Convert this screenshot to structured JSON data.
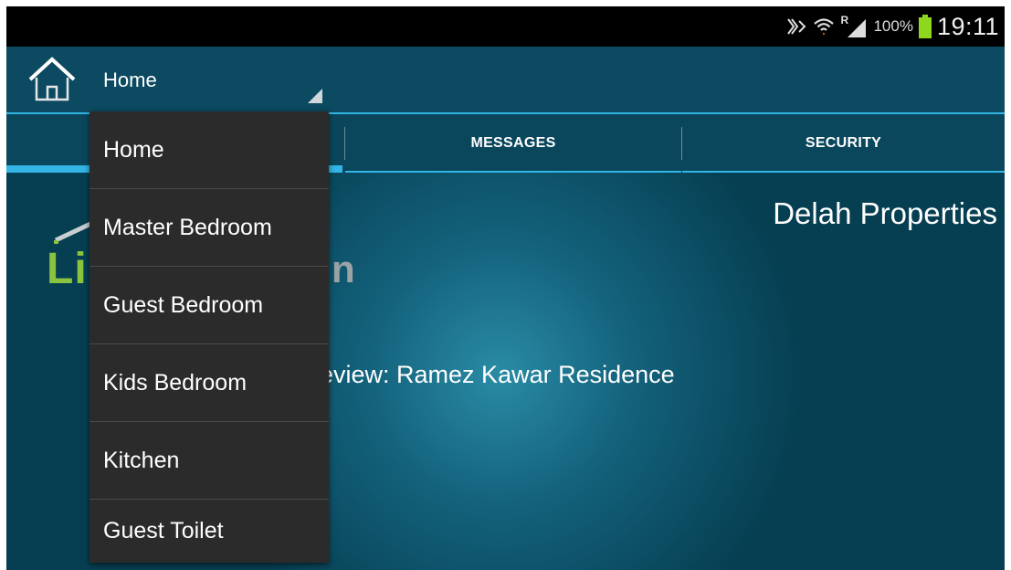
{
  "status_bar": {
    "battery_percent": "100%",
    "time": "19:11",
    "icons": [
      "nfc-icon",
      "wifi-icon",
      "roaming-icon",
      "signal-icon",
      "battery-icon"
    ],
    "roaming_label": "R",
    "battery_color": "#8fd61f"
  },
  "action_bar": {
    "spinner_selected": "Home",
    "home_icon": "house-icon",
    "accent_color": "#33b5e5"
  },
  "tabs": [
    {
      "label": ""
    },
    {
      "label": "MESSAGES"
    },
    {
      "label": "SECURITY"
    }
  ],
  "content": {
    "property_name": "Delah Properties",
    "preview_text": "eview: Ramez Kawar Residence",
    "logo_visible_left": "Li",
    "logo_visible_right": "n"
  },
  "dropdown": {
    "items": [
      {
        "label": "Home"
      },
      {
        "label": "Master Bedroom"
      },
      {
        "label": "Guest Bedroom"
      },
      {
        "label": "Kids Bedroom"
      },
      {
        "label": "Kitchen"
      },
      {
        "label": "Guest Toilet"
      }
    ]
  }
}
